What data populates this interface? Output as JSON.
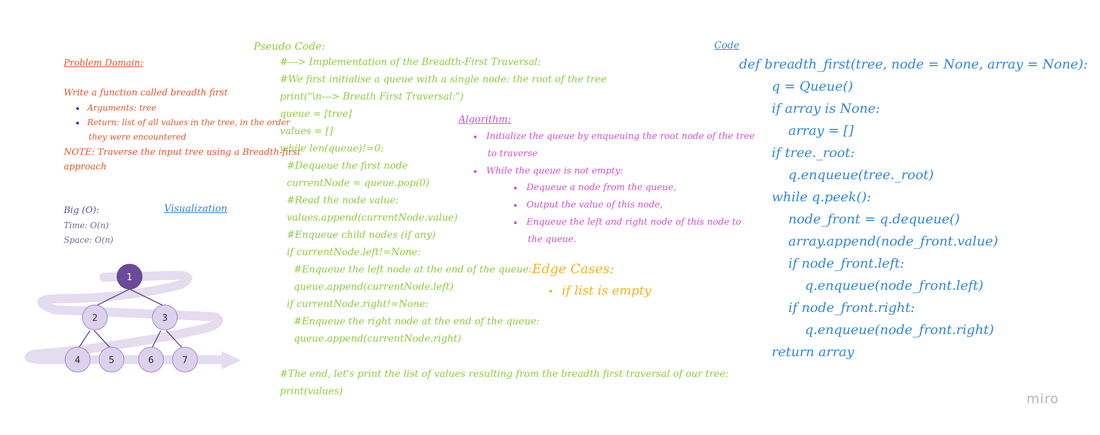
{
  "problem_domain": {
    "title": "Problem Domain:",
    "line1": "Write a function called breadth first",
    "bullet1": "Arguments: tree",
    "bullet2a": "Return: list of all values in the tree, in the order",
    "bullet2b": "they were encountered",
    "note1": "NOTE: Traverse the input tree using a Breadth-first",
    "note2": "approach"
  },
  "big_o": {
    "title": "Big (O):",
    "time": "Time: O(n)",
    "space": "Space: O(n)"
  },
  "visualization": {
    "title": "Visualization",
    "nodes": [
      "1",
      "2",
      "3",
      "4",
      "5",
      "6",
      "7"
    ],
    "colors": {
      "root": "#6b4a9a",
      "node": "#dcd2ee",
      "edge": "#5a3f8c",
      "arrow": "#e4dcef"
    }
  },
  "pseudo_code": {
    "title": "Pseudo Code:",
    "lines": [
      "#---> Implementation of the Breadth-First Traversal:",
      "#We first initialise a queue with a single node: the root of the tree",
      "print(\"\\n---> Breath First Traversal:\")",
      "queue = [tree]",
      "values = []",
      "while len(queue)!=0:",
      "#Dequeue the first node",
      "currentNode = queue.pop(0)",
      "#Read the node value:",
      "values.append(currentNode.value)",
      "#Enqueue child nodes (if any)",
      "if currentNode.left!=None:",
      "#Enqueue the left node at the end of the queue:",
      "queue.append(currentNode.left)",
      "if currentNode.right!=None:",
      "#Enqueue the right node at the end of the queue:",
      "queue.append(currentNode.right)",
      "#The end, let's print the list of values resulting from the breadth first traversal of our tree:",
      "print(values)"
    ]
  },
  "algorithm": {
    "title": "Algorithm:",
    "item1a": "Initialize the queue by enqueuing the root node of the tree",
    "item1b": "to traverse",
    "item2": "While the queue is not empty:",
    "sub1": "Dequeue a node from the queue,",
    "sub2": "Output the value of this node,",
    "sub3a": "Enqueue the left and right node of this node to",
    "sub3b": "the queue."
  },
  "edge_cases": {
    "title": "Edge Cases:",
    "item": "if list is empty"
  },
  "code": {
    "title": "Code",
    "lines": [
      "def breadth_first(tree, node = None, array = None):",
      "q = Queue()",
      "if array is None:",
      "array = []",
      "if tree._root:",
      "q.enqueue(tree._root)",
      "while q.peek():",
      "node_front = q.dequeue()",
      "array.append(node_front.value)",
      "if node_front.left:",
      "q.enqueue(node_front.left)",
      "if node_front.right:",
      "q.enqueue(node_front.right)",
      "return array"
    ]
  },
  "brand": "miro"
}
